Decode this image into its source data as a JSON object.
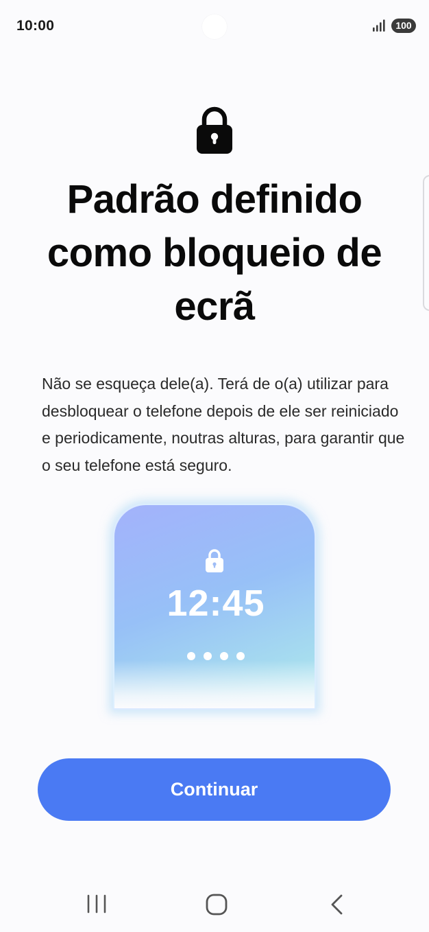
{
  "status_bar": {
    "time": "10:00",
    "battery": "100",
    "icons": [
      "signal-icon",
      "battery-icon"
    ]
  },
  "header": {
    "icon": "lock-icon",
    "title": "Padrão definido como bloqueio de ecrã"
  },
  "body": {
    "description": "Não se esqueça dele(a). Terá de o(a) utilizar para desbloquear o telefone depois de ele ser reiniciado e periodicamente, noutras alturas, para garantir que o seu telefone está seguro."
  },
  "illustration": {
    "clock": "12:45",
    "pin_dot_count": 4,
    "icon": "lock-icon"
  },
  "actions": {
    "continue_label": "Continuar"
  },
  "nav_bar": {
    "icons": [
      "recents-icon",
      "home-icon",
      "back-icon"
    ]
  },
  "colors": {
    "accent": "#4a7af3",
    "background": "#fbfbfd",
    "title_text": "#0a0a0a",
    "body_text": "#2a2a2a",
    "illustration_gradient_start": "#a3b2fb",
    "illustration_gradient_end": "#b8ecf2"
  }
}
